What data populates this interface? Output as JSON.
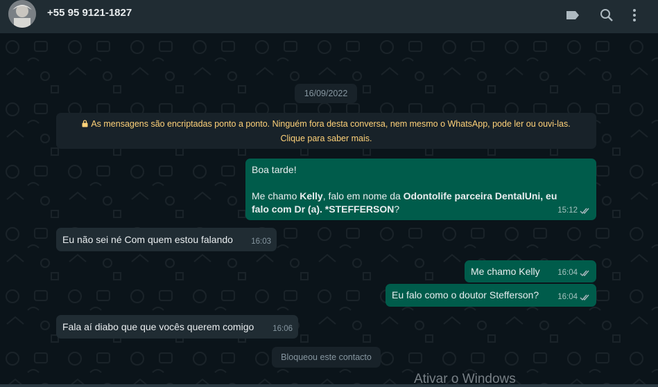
{
  "header": {
    "contact": "+55 95 9121-1827",
    "icons": [
      "label-icon",
      "search-icon",
      "menu-icon"
    ]
  },
  "chat": {
    "date_label": "16/09/2022",
    "encryption_line1": "As mensagens são encriptadas ponto a ponto. Ninguém fora desta conversa, nem mesmo o WhatsApp, pode ler ou ouvi-las.",
    "encryption_line2": "Clique para saber mais.",
    "msg1": {
      "greeting": "Boa tarde!",
      "p1": "Me chamo ",
      "b1": "Kelly",
      "p2": ", falo em nome da ",
      "b2": "Odontolife parceira DentalUni, eu falo com Dr (a). *STEFFERSON",
      "p3": "?",
      "time": "15:12"
    },
    "msg2": {
      "text": "Eu não sei né Com quem estou falando",
      "time": "16:03"
    },
    "msg3": {
      "text": "Me chamo Kelly",
      "time": "16:04"
    },
    "msg4": {
      "text": "Eu falo como o doutor Stefferson?",
      "time": "16:04"
    },
    "msg5": {
      "text": "Fala aí diabo que que vocês querem comigo",
      "time": "16:06"
    },
    "blocked_label": "Bloqueou este contacto"
  },
  "watermark": "Ativar o Windows",
  "colors": {
    "header": "#202c33",
    "outgoing": "#005c4b",
    "incoming": "#202c33",
    "background": "#0b141a",
    "system_text": "#ffd279"
  }
}
